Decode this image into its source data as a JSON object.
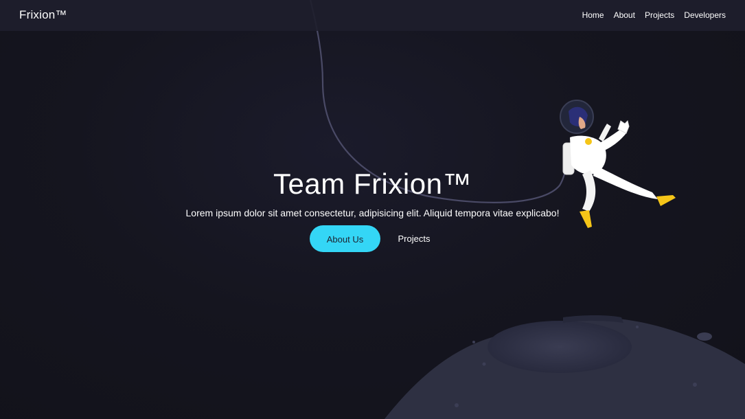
{
  "navbar": {
    "brand": "Frixion™",
    "links": [
      {
        "label": "Home"
      },
      {
        "label": "About"
      },
      {
        "label": "Projects"
      },
      {
        "label": "Developers"
      }
    ]
  },
  "hero": {
    "title": "Team Frixion™",
    "subtitle": "Lorem ipsum dolor sit amet consectetur, adipisicing elit. Aliquid tempora vitae explicabo!",
    "primary_button": "About Us",
    "secondary_button": "Projects"
  },
  "colors": {
    "accent": "#34d6f6",
    "background": "#13131f",
    "navbar": "#1e1e2c",
    "planet": "#2e3042",
    "boots": "#f5c518"
  },
  "illustrations": [
    "astronaut-illustration",
    "planet-illustration",
    "tether-line"
  ]
}
